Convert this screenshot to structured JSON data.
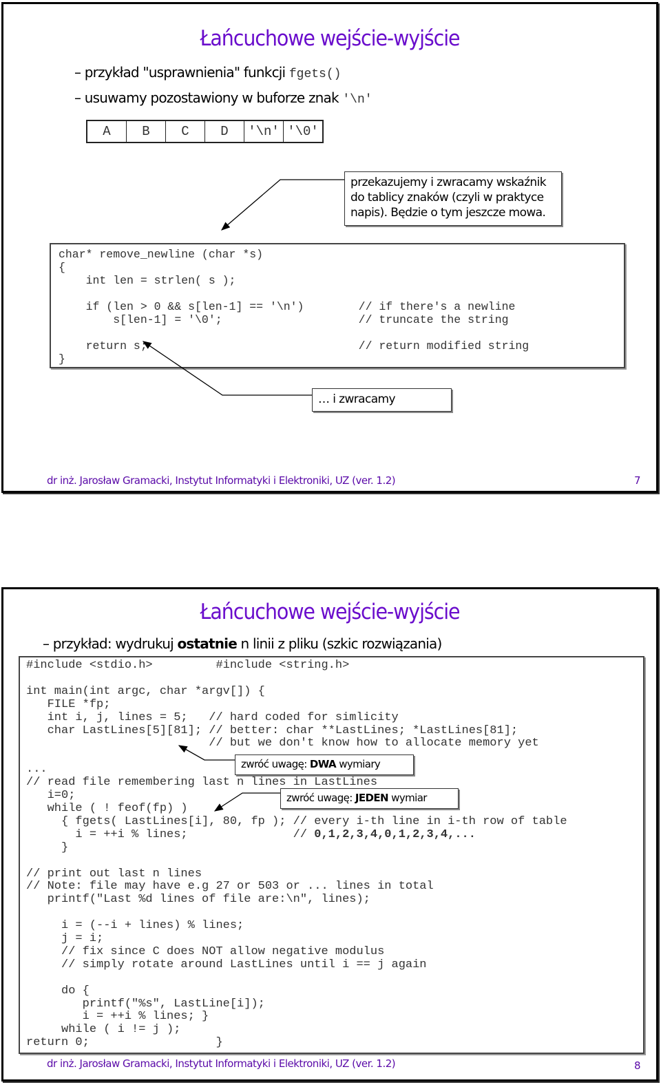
{
  "slides": [
    {
      "title": "Łańcuchowe wejście-wyjście",
      "bullets": [
        {
          "text": "– przykład \"usprawnienia\" funkcji ",
          "code": "fgets()"
        },
        {
          "text": "– usuwamy pozostawiony w buforze znak ",
          "code": "'\\n'"
        }
      ],
      "char_array": [
        "A",
        "B",
        "C",
        "D",
        "'\\n'",
        "'\\0'"
      ],
      "callout_pointer": "przekazujemy i zwracamy wskaźnik do tablicy znaków (czyli w praktyce napis). Będzie o tym jeszcze mowa.",
      "code_lines": [
        "char* remove_newline (char *s)",
        "{",
        "    int len = strlen( s );",
        "",
        "    if (len > 0 && s[len-1] == '\\n')        // if there's a newline",
        "        s[len-1] = '\\0';                    // truncate the string",
        "",
        "    return s;                               // return modified string",
        "}"
      ],
      "callout_return": "… i zwracamy",
      "footer": "dr inż. Jarosław Gramacki, Instytut Informatyki i Elektroniki, UZ (ver. 1.2)",
      "page_number": "7"
    },
    {
      "title": "Łańcuchowe wejście-wyjście",
      "bullet": {
        "prefix": "– przykład: wydrukuj ",
        "bold": "ostatnie",
        "suffix": " n linii z pliku (szkic rozwiązania)"
      },
      "code_lines": [
        "#include <stdio.h>         #include <string.h>",
        "",
        "int main(int argc, char *argv[]) {",
        "   FILE *fp;",
        "   int i, j, lines = 5;   // hard coded for simlicity",
        "   char LastLines[5][81]; // better: char **LastLines; *LastLines[81];",
        "                          // but we don't know how to allocate memory yet",
        "",
        "...",
        "// read file remembering last n lines in LastLines",
        "   i=0;",
        "   while ( ! feof(fp) )",
        "     { fgets( LastLines[i], 80, fp ); // every i-th line in i-th row of table",
        "       i = ++i % lines;               // ",
        "     }",
        "",
        "// print out last n lines",
        "// Note: file may have e.g 27 or 503 or ... lines in total",
        "   printf(\"Last %d lines of file are:\\n\", lines);",
        "",
        "     i = (--i + lines) % lines;",
        "     j = i;",
        "     // fix since C does NOT allow negative modulus",
        "     // simply rotate around LastLines until i == j again",
        "",
        "     do {",
        "        printf(\"%s\", LastLine[i]);",
        "        i = ++i % lines; }",
        "     while ( i != j );",
        "return 0;                  }"
      ],
      "bold_sequence": "0,1,2,3,4,0,1,2,3,4,...",
      "callout_two_dims": {
        "prefix": "zwróć uwagę: ",
        "bold": "DWA",
        "suffix": " wymiary"
      },
      "callout_one_dim": {
        "prefix": "zwróć uwagę: ",
        "bold": "JEDEN",
        "suffix": " wymiar"
      },
      "footer": "dr inż. Jarosław Gramacki, Instytut Informatyki i Elektroniki, UZ (ver. 1.2)",
      "page_number": "8"
    }
  ]
}
